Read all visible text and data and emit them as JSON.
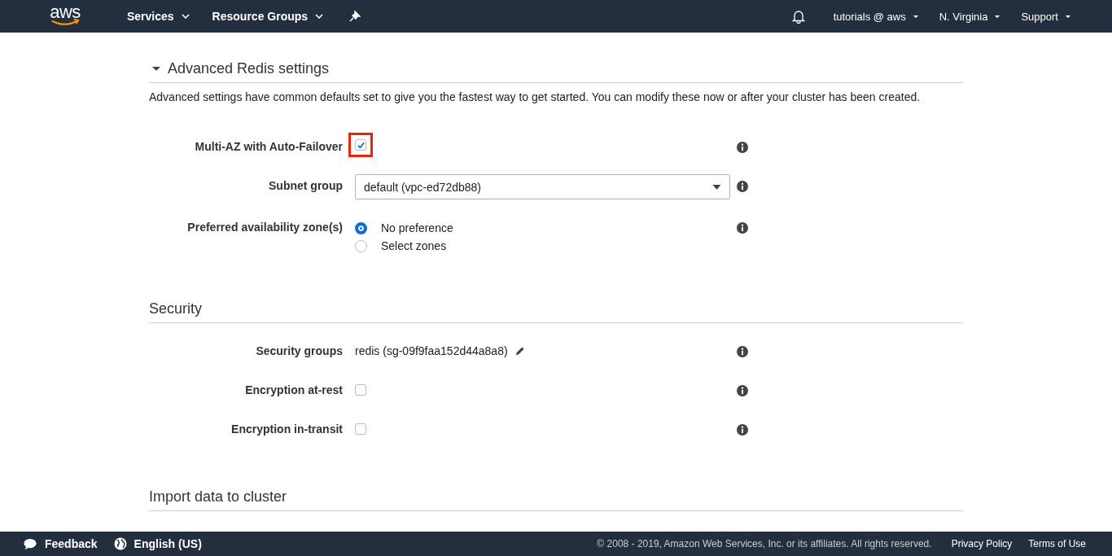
{
  "nav": {
    "logo": "aws",
    "menus": [
      {
        "label": "Services"
      },
      {
        "label": "Resource Groups"
      }
    ],
    "right_menus": [
      {
        "label": "tutorials @ aws"
      },
      {
        "label": "N. Virginia"
      },
      {
        "label": "Support"
      }
    ]
  },
  "sections": [
    {
      "title": "Advanced Redis settings",
      "expanded": true,
      "description": "Advanced settings have common defaults set to give you the fastest way to get started. You can modify these now or after your cluster has been created.",
      "rows": [
        {
          "kind": "checkbox",
          "label": "Multi-AZ with Auto-Failover",
          "checked": true,
          "highlighted": true
        },
        {
          "kind": "select",
          "label": "Subnet group",
          "value": "default (vpc-ed72db88)"
        },
        {
          "kind": "radio",
          "label": "Preferred availability zone(s)",
          "options": [
            {
              "label": "No preference",
              "selected": true
            },
            {
              "label": "Select zones",
              "selected": false
            }
          ]
        }
      ]
    },
    {
      "title": "Security",
      "rows": [
        {
          "kind": "text",
          "label": "Security groups",
          "value": "redis (sg-09f9faa152d44a8a8)"
        },
        {
          "kind": "checkbox",
          "label": "Encryption at-rest",
          "checked": false,
          "highlighted": false
        },
        {
          "kind": "checkbox",
          "label": "Encryption in-transit",
          "checked": false,
          "highlighted": false
        }
      ]
    },
    {
      "title": "Import data to cluster"
    }
  ],
  "footer": {
    "feedback": "Feedback",
    "language": "English (US)",
    "copyright": "© 2008 - 2019, Amazon Web Services, Inc. or its affiliates. All rights reserved.",
    "links": [
      "Privacy Policy",
      "Terms of Use"
    ]
  }
}
